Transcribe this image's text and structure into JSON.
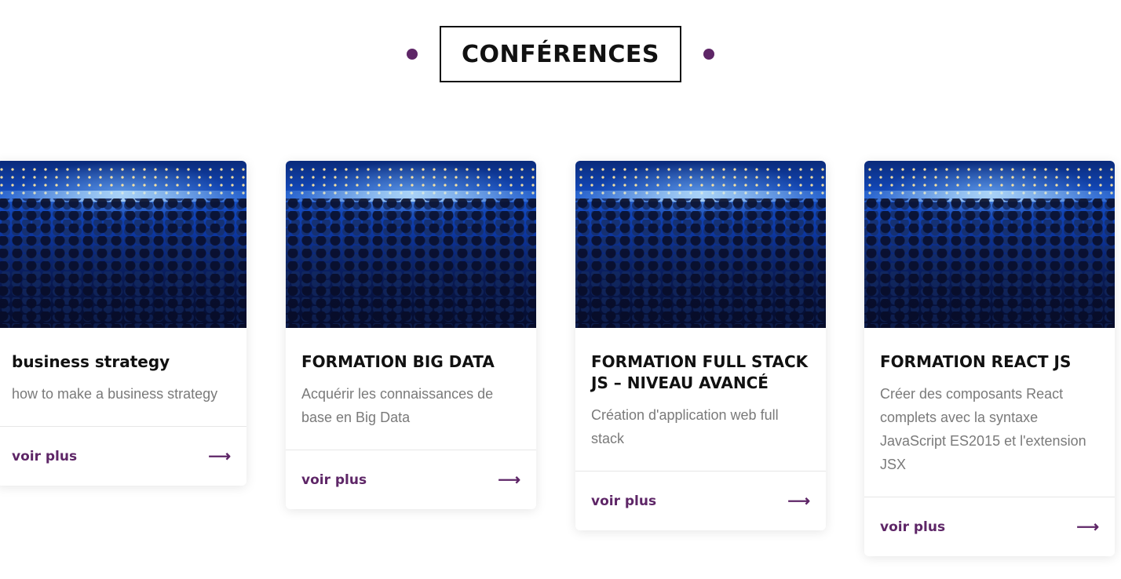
{
  "section": {
    "title": "CONFÉRENCES"
  },
  "cards": [
    {
      "title": "business strategy",
      "description": "how to make a business strategy",
      "link_label": "voir plus",
      "link_icon": "arrow-right-icon"
    },
    {
      "title": "FORMATION BIG DATA",
      "description": "Acquérir les connaissances de base en Big Data",
      "link_label": "voir plus",
      "link_icon": "arrow-right-icon"
    },
    {
      "title": "FORMATION FULL STACK JS – NIVEAU AVANCÉ",
      "description": "Création d'application web full stack",
      "link_label": "voir plus",
      "link_icon": "arrow-right-icon"
    },
    {
      "title": "FORMATION REACT JS",
      "description": "Créer des composants React complets avec la syntaxe JavaScript ES2015 et l'extension JSX",
      "link_label": "voir plus",
      "link_icon": "arrow-right-icon"
    }
  ],
  "colors": {
    "accent": "#5e2667",
    "text": "#111111",
    "muted": "#7a7a7a"
  }
}
